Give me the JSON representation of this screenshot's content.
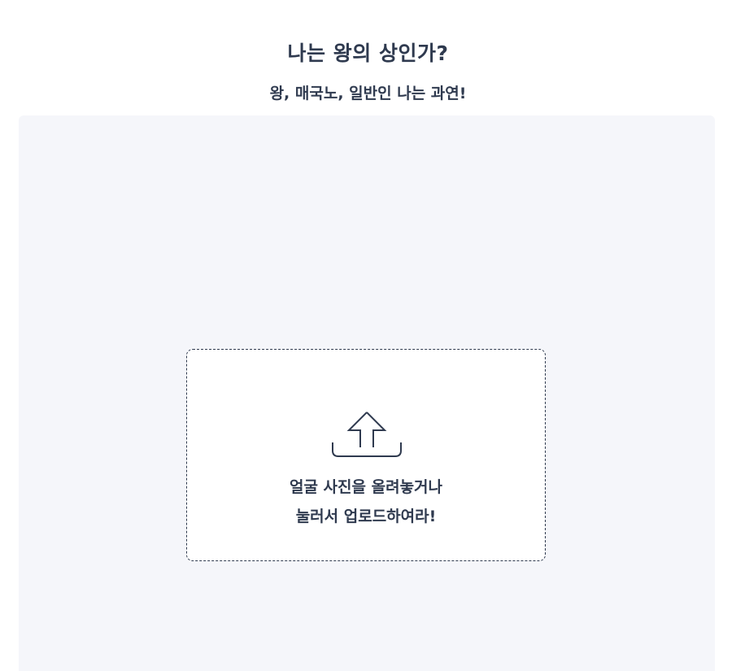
{
  "header": {
    "title": "나는 왕의 상인가?",
    "subtitle": "왕, 매국노, 일반인 나는 과연!"
  },
  "upload": {
    "icon": "upload-icon",
    "line1": "얼굴 사진을 올려놓거나",
    "line2": "눌러서 업로드하여라!"
  },
  "colors": {
    "text": "#2f3a4f",
    "panel_bg": "#f5f6fa",
    "dropzone_bg": "#ffffff"
  }
}
